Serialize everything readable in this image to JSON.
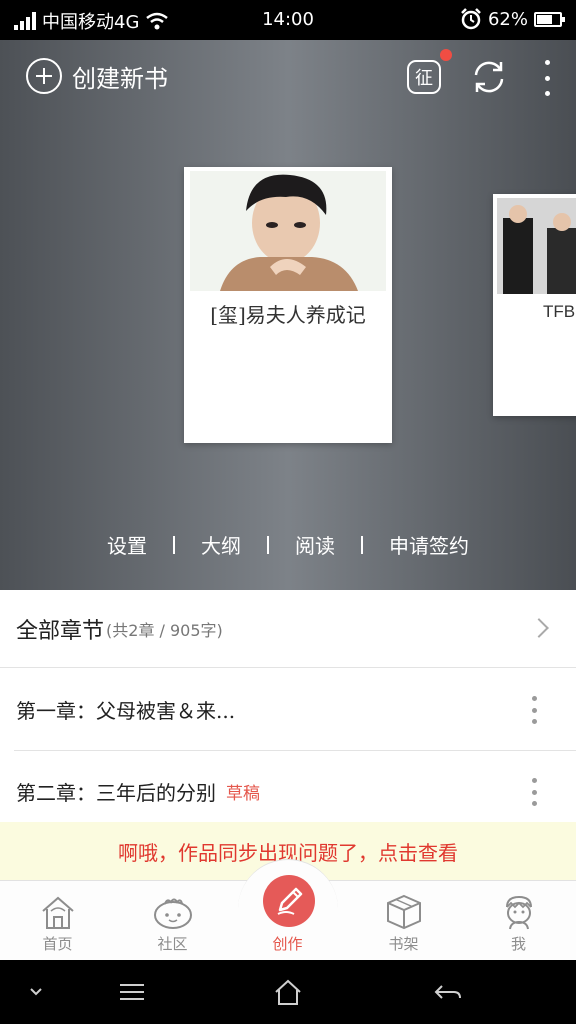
{
  "status_bar": {
    "carrier": "中国移动4G",
    "time": "14:00",
    "battery": "62%",
    "battery_level": 0.62
  },
  "header": {
    "create_label": "创建新书",
    "badge_label": "征"
  },
  "books": [
    {
      "title": "[玺]易夫人养成记"
    },
    {
      "title": "TFB"
    }
  ],
  "actions": [
    "设置",
    "大纲",
    "阅读",
    "申请签约"
  ],
  "chapters": {
    "all_label": "全部章节",
    "summary": "(共2章 / 905字)",
    "items": [
      {
        "title": "第一章：父母被害＆来...",
        "tag": ""
      },
      {
        "title": "第二章：三年后的分别",
        "tag": "草稿"
      }
    ]
  },
  "warning": "啊哦，作品同步出现问题了，点击查看",
  "tabs": [
    {
      "label": "首页",
      "icon": "home-icon"
    },
    {
      "label": "社区",
      "icon": "community-icon"
    },
    {
      "label": "创作",
      "icon": "pen-icon"
    },
    {
      "label": "书架",
      "icon": "bookshelf-icon"
    },
    {
      "label": "我",
      "icon": "profile-icon"
    }
  ],
  "colors": {
    "accent": "#e4574c",
    "warning_bg": "#fbfbdf"
  }
}
